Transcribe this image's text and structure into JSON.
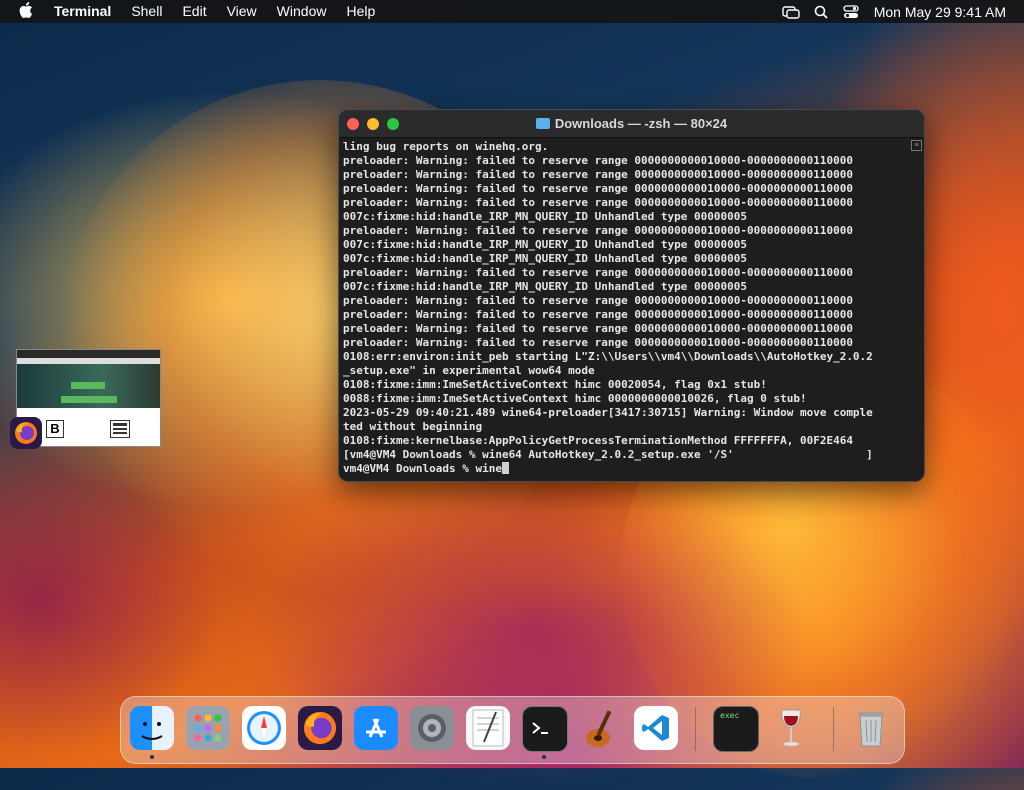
{
  "menubar": {
    "app_name": "Terminal",
    "menus": [
      "Shell",
      "Edit",
      "View",
      "Window",
      "Help"
    ],
    "clock": "Mon May 29  9:41 AM"
  },
  "terminal": {
    "title": "Downloads — -zsh — 80×24",
    "lines": [
      "ling bug reports on winehq.org.",
      "preloader: Warning: failed to reserve range 0000000000010000-0000000000110000",
      "preloader: Warning: failed to reserve range 0000000000010000-0000000000110000",
      "preloader: Warning: failed to reserve range 0000000000010000-0000000000110000",
      "preloader: Warning: failed to reserve range 0000000000010000-0000000000110000",
      "007c:fixme:hid:handle_IRP_MN_QUERY_ID Unhandled type 00000005",
      "preloader: Warning: failed to reserve range 0000000000010000-0000000000110000",
      "007c:fixme:hid:handle_IRP_MN_QUERY_ID Unhandled type 00000005",
      "007c:fixme:hid:handle_IRP_MN_QUERY_ID Unhandled type 00000005",
      "preloader: Warning: failed to reserve range 0000000000010000-0000000000110000",
      "007c:fixme:hid:handle_IRP_MN_QUERY_ID Unhandled type 00000005",
      "preloader: Warning: failed to reserve range 0000000000010000-0000000000110000",
      "preloader: Warning: failed to reserve range 0000000000010000-0000000000110000",
      "preloader: Warning: failed to reserve range 0000000000010000-0000000000110000",
      "preloader: Warning: failed to reserve range 0000000000010000-0000000000110000",
      "0108:err:environ:init_peb starting L\"Z:\\\\Users\\\\vm4\\\\Downloads\\\\AutoHotkey_2.0.2",
      "_setup.exe\" in experimental wow64 mode",
      "0108:fixme:imm:ImeSetActiveContext himc 00020054, flag 0x1 stub!",
      "0088:fixme:imm:ImeSetActiveContext himc 0000000000010026, flag 0 stub!",
      "2023-05-29 09:40:21.489 wine64-preloader[3417:30715] Warning: Window move comple",
      "ted without beginning",
      "0108:fixme:kernelbase:AppPolicyGetProcessTerminationMethod FFFFFFFA, 00F2E464",
      "[vm4@VM4 Downloads % wine64 AutoHotkey_2.0.2_setup.exe '/S'                    ]"
    ],
    "prompt": "vm4@VM4 Downloads % ",
    "input": "wine"
  },
  "thumbnail": {
    "letter": "B"
  },
  "dock": {
    "apps": [
      "Finder",
      "Launchpad",
      "Safari",
      "Firefox",
      "App Store",
      "System Settings",
      "TextEdit",
      "Terminal",
      "GarageBand",
      "Visual Studio Code",
      "exec",
      "Wine",
      "Trash"
    ],
    "exec_label": "exec"
  },
  "colors": {
    "close": "#ff5f57",
    "minimize": "#febc2e",
    "zoom": "#28c840"
  }
}
